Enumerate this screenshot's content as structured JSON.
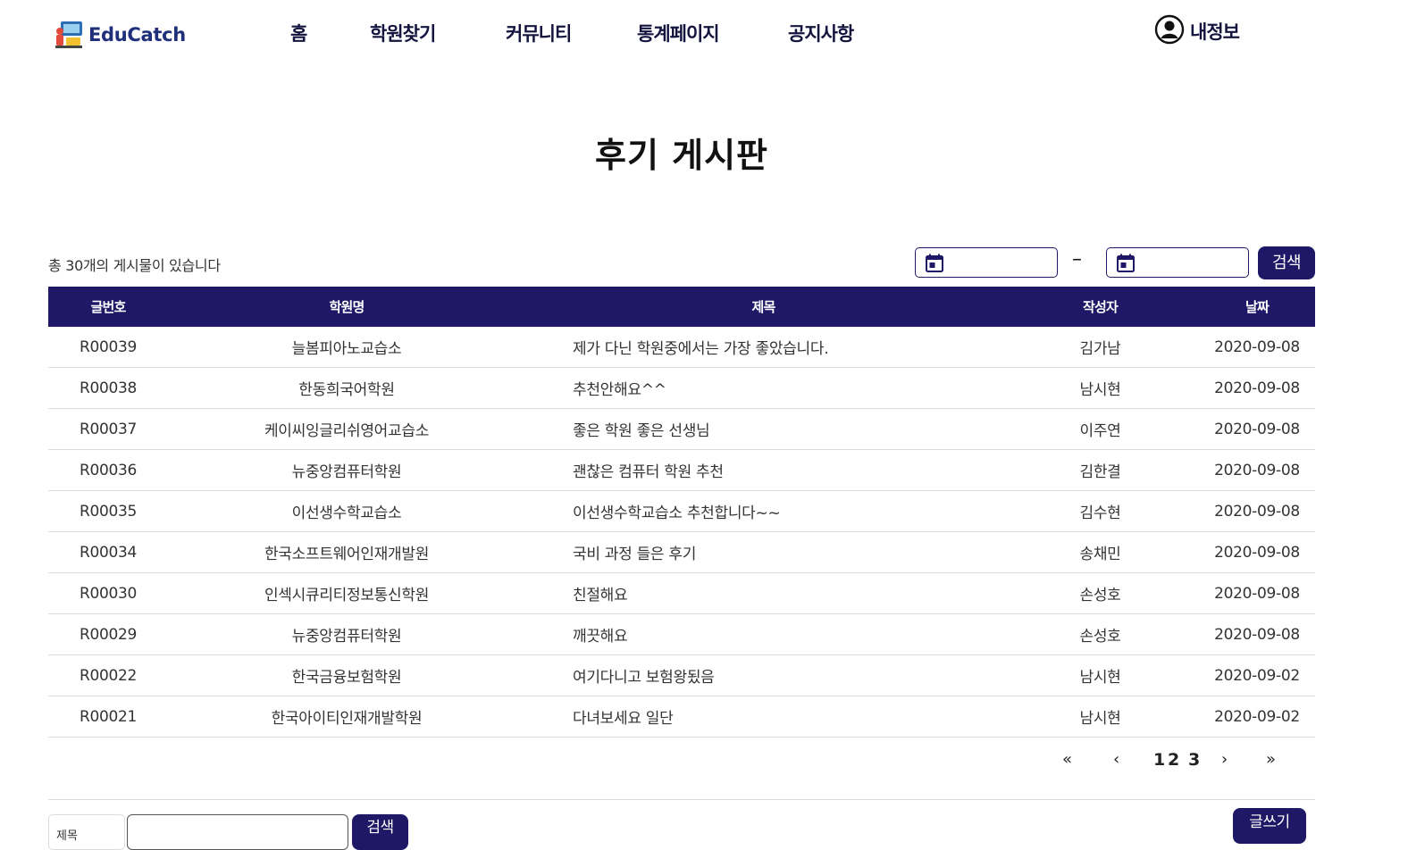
{
  "header": {
    "logo_text": "EduCatch",
    "nav": [
      "홈",
      "학원찾기",
      "커뮤니티",
      "통계페이지",
      "공지사항"
    ],
    "myinfo_label": "내정보"
  },
  "page_title": "후기 게시판",
  "toolbar": {
    "total_text": "총 30개의 게시물이 있습니다",
    "date_separator": "–",
    "search_button": "검색"
  },
  "table": {
    "columns": [
      "글번호",
      "학원명",
      "제목",
      "작성자",
      "날짜"
    ],
    "rows": [
      {
        "no": "R00039",
        "academy": "늘봄피아노교습소",
        "title": "제가 다닌 학원중에서는 가장 좋았습니다.",
        "writer": "김가남",
        "date": "2020-09-08"
      },
      {
        "no": "R00038",
        "academy": "한동희국어학원",
        "title": "추천안해요^^",
        "writer": "남시현",
        "date": "2020-09-08"
      },
      {
        "no": "R00037",
        "academy": "케이씨잉글리쉬영어교습소",
        "title": "좋은 학원 좋은 선생님",
        "writer": "이주연",
        "date": "2020-09-08"
      },
      {
        "no": "R00036",
        "academy": "뉴중앙컴퓨터학원",
        "title": "괜찮은 컴퓨터 학원 추천",
        "writer": "김한결",
        "date": "2020-09-08"
      },
      {
        "no": "R00035",
        "academy": "이선생수학교습소",
        "title": "이선생수학교습소 추천합니다~~",
        "writer": "김수현",
        "date": "2020-09-08"
      },
      {
        "no": "R00034",
        "academy": "한국소프트웨어인재개발원",
        "title": "국비 과정 들은 후기",
        "writer": "송채민",
        "date": "2020-09-08"
      },
      {
        "no": "R00030",
        "academy": "인섹시큐리티정보통신학원",
        "title": "친절해요",
        "writer": "손성호",
        "date": "2020-09-08"
      },
      {
        "no": "R00029",
        "academy": "뉴중앙컴퓨터학원",
        "title": "깨끗해요",
        "writer": "손성호",
        "date": "2020-09-08"
      },
      {
        "no": "R00022",
        "academy": "한국금융보험학원",
        "title": "여기다니고 보험왕됬음",
        "writer": "남시현",
        "date": "2020-09-02"
      },
      {
        "no": "R00021",
        "academy": "한국아이티인재개발학원",
        "title": "다녀보세요 일단",
        "writer": "남시현",
        "date": "2020-09-02"
      }
    ]
  },
  "pagination": {
    "first": "«",
    "prev": "‹",
    "pages": [
      "1",
      "2",
      "3"
    ],
    "next": "›",
    "last": "»"
  },
  "bottom": {
    "search_type": "제목",
    "search_button": "검색",
    "write_button": "글쓰기"
  },
  "colors": {
    "navy": "#1e1866",
    "nav_text": "#14143f",
    "logo_text": "#1f2f7a"
  }
}
